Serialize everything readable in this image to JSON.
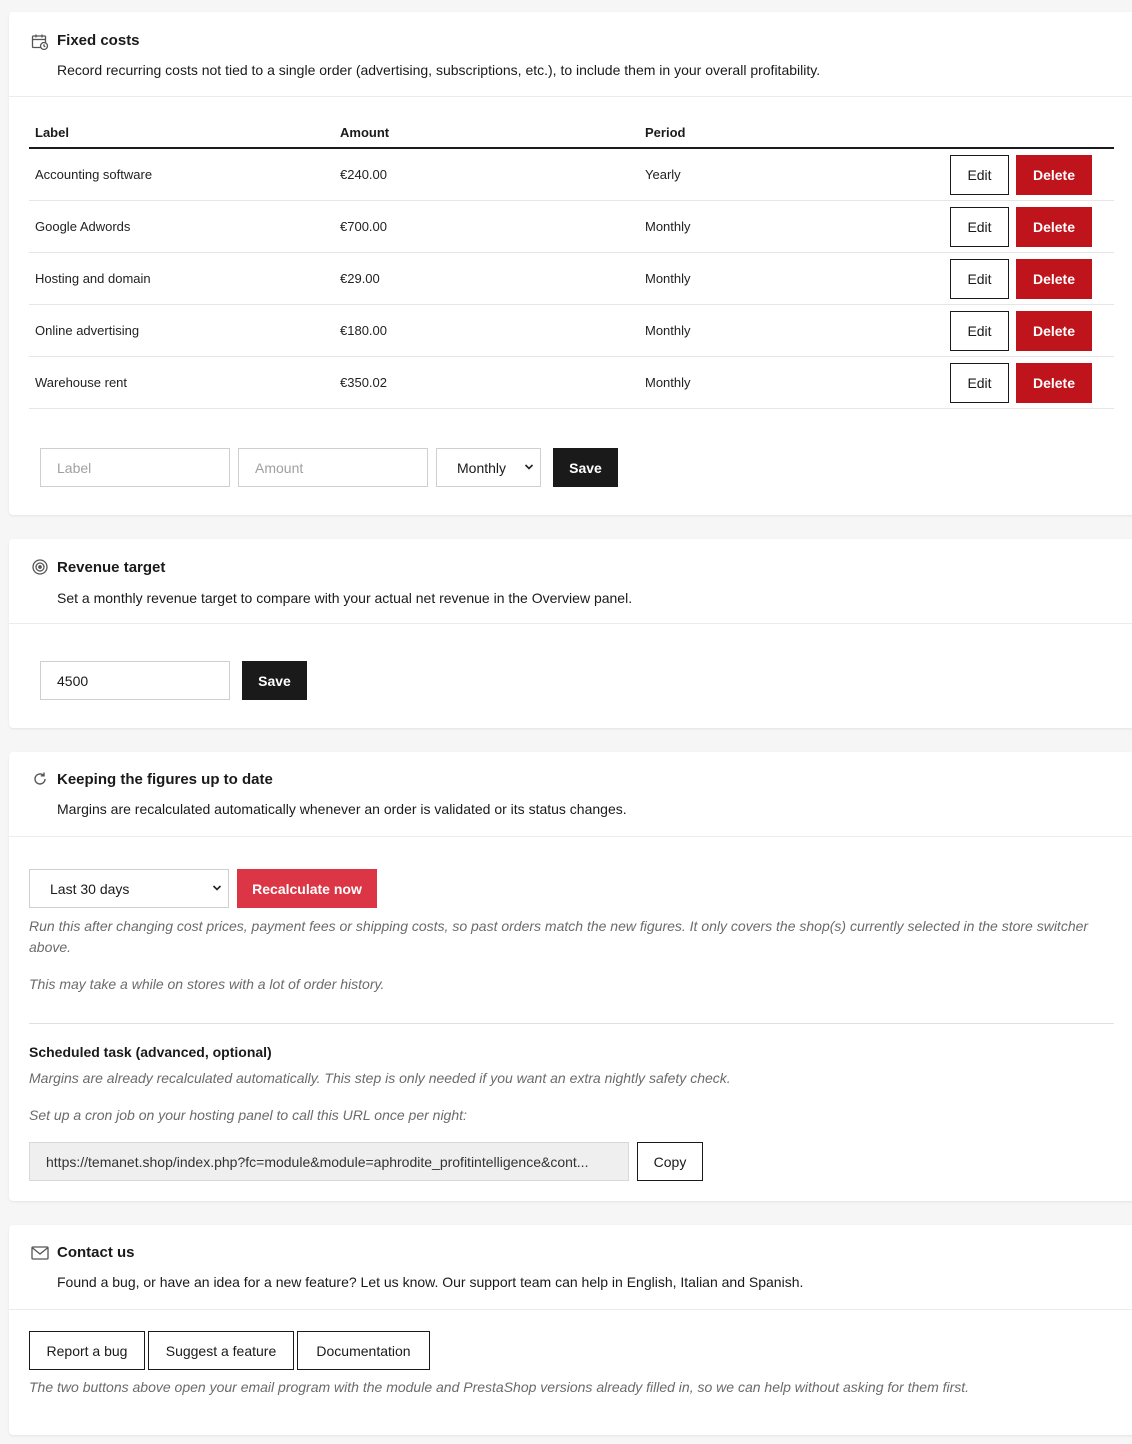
{
  "fixed_costs": {
    "title": "Fixed costs",
    "subtitle": "Record recurring costs not tied to a single order (advertising, subscriptions, etc.), to include them in your overall profitability.",
    "columns": [
      "Label",
      "Amount",
      "Period"
    ],
    "rows": [
      {
        "label": "Accounting software",
        "amount": "€240.00",
        "period": "Yearly"
      },
      {
        "label": "Google Adwords",
        "amount": "€700.00",
        "period": "Monthly"
      },
      {
        "label": "Hosting and domain",
        "amount": "€29.00",
        "period": "Monthly"
      },
      {
        "label": "Online advertising",
        "amount": "€180.00",
        "period": "Monthly"
      },
      {
        "label": "Warehouse rent",
        "amount": "€350.02",
        "period": "Monthly"
      }
    ],
    "edit_label": "Edit",
    "delete_label": "Delete",
    "form": {
      "label_placeholder": "Label",
      "amount_placeholder": "Amount",
      "period_value": "Monthly",
      "save_label": "Save"
    }
  },
  "revenue_target": {
    "title": "Revenue target",
    "subtitle": "Set a monthly revenue target to compare with your actual net revenue in the Overview panel.",
    "value": "4500",
    "save_label": "Save"
  },
  "keeping_up_to_date": {
    "title": "Keeping the figures up to date",
    "subtitle": "Margins are recalculated automatically whenever an order is validated or its status changes.",
    "range_value": "Last 30 days",
    "recalculate_label": "Recalculate now",
    "note1": "Run this after changing cost prices, payment fees or shipping costs, so past orders match the new figures. It only covers the shop(s) currently selected in the store switcher above.",
    "note2": "This may take a while on stores with a lot of order history.",
    "scheduled_title": "Scheduled task (advanced, optional)",
    "scheduled_note": "Margins are already recalculated automatically. This step is only needed if you want an extra nightly safety check.",
    "cron_note": "Set up a cron job on your hosting panel to call this URL once per night:",
    "cron_url": "https://temanet.shop/index.php?fc=module&module=aphrodite_profitintelligence&cont...",
    "copy_label": "Copy"
  },
  "contact": {
    "title": "Contact us",
    "subtitle": "Found a bug, or have an idea for a new feature? Let us know. Our support team can help in English, Italian and Spanish.",
    "report_bug_label": "Report a bug",
    "suggest_feature_label": "Suggest a feature",
    "documentation_label": "Documentation",
    "note": "The two buttons above open your email program with the module and PrestaShop versions already filled in, so we can help without asking for them first."
  },
  "colors": {
    "danger": "#c0141d",
    "dark": "#1a1a1a",
    "recalculate": "#dc3545"
  }
}
